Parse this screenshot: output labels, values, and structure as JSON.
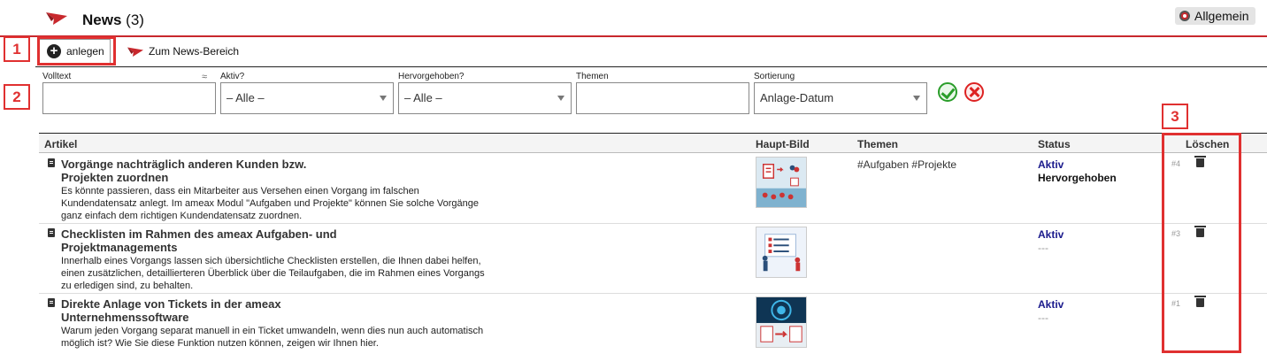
{
  "header": {
    "title": "News",
    "count": "(3)",
    "scope_label": "Allgemein"
  },
  "toolbar": {
    "create_label": "anlegen",
    "news_link": "Zum News-Bereich"
  },
  "filters": {
    "fulltext": {
      "label": "Volltext",
      "value": "",
      "approx": "≈"
    },
    "active": {
      "label": "Aktiv?",
      "value": "– Alle –"
    },
    "featured": {
      "label": "Hervorgehoben?",
      "value": "– Alle –"
    },
    "themes": {
      "label": "Themen",
      "value": ""
    },
    "sort": {
      "label": "Sortierung",
      "value": "Anlage-Datum"
    }
  },
  "table": {
    "columns": [
      "Artikel",
      "Haupt-Bild",
      "Themen",
      "Status",
      "Löschen"
    ],
    "rows": [
      {
        "title": "Vorgänge nachträglich anderen Kunden bzw. Projekten zuordnen",
        "description": "Es könnte passieren, dass ein Mitarbeiter aus Versehen einen Vorgang im falschen Kundendatensatz anlegt. Im ameax Modul \"Aufgaben und Projekte\" können Sie solche Vorgänge ganz einfach dem richtigen Kundendatensatz zuordnen.",
        "themes": "#Aufgaben #Projekte",
        "status": "Aktiv",
        "status2": "Hervorgehoben",
        "number": "#4"
      },
      {
        "title": "Checklisten im Rahmen des ameax Aufgaben- und Projektmanagements",
        "description": "Innerhalb eines Vorgangs lassen sich übersichtliche Checklisten erstellen, die Ihnen dabei helfen, einen zusätzlichen, detaillierteren Überblick über die Teilaufgaben, die im Rahmen eines Vorgangs zu erledigen sind, zu behalten.",
        "themes": "",
        "status": "Aktiv",
        "status2": "---",
        "number": "#3"
      },
      {
        "title": "Direkte Anlage von Tickets in der ameax Unternehmenssoftware",
        "description": "Warum jeden Vorgang separat manuell in ein Ticket umwandeln, wenn dies nun auch automatisch möglich ist? Wie Sie diese Funktion nutzen können, zeigen wir Ihnen hier.",
        "themes": "",
        "status": "Aktiv",
        "status2": "---",
        "number": "#1"
      }
    ]
  },
  "annotations": {
    "marker1": "1",
    "marker2": "2",
    "marker3": "3"
  },
  "colors": {
    "accent": "#c8282d",
    "annotation": "#e03030",
    "active_status": "#1a1a8c"
  }
}
